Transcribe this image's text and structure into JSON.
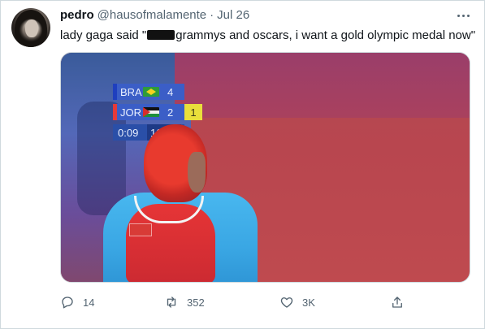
{
  "tweet": {
    "author": {
      "display_name": "pedro",
      "handle": "@hausofmalamente"
    },
    "separator": "·",
    "timestamp": "Jul 26",
    "text_before": "lady gaga said \"",
    "text_after": "grammys and oscars, i want a gold olympic medal now\"",
    "media": {
      "scoreboard": {
        "row1": {
          "code": "BRA",
          "score": "4"
        },
        "row2": {
          "code": "JOR",
          "score": "2",
          "penalty": "1"
        },
        "clock": "0:09",
        "round": "1ST"
      }
    },
    "actions": {
      "reply_count": "14",
      "retweet_count": "352",
      "like_count": "3K"
    }
  },
  "icons": {
    "more": "more-horizontal-icon",
    "reply": "reply-icon",
    "retweet": "retweet-icon",
    "like": "heart-icon",
    "share": "share-icon"
  },
  "colors": {
    "text_primary": "#0f1419",
    "text_secondary": "#536471",
    "border": "#cfd9de"
  }
}
